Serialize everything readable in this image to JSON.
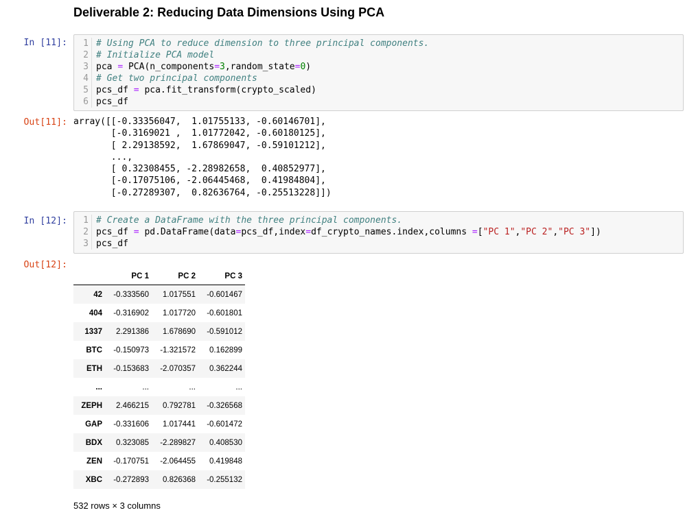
{
  "heading": "Deliverable 2: Reducing Data Dimensions Using PCA",
  "cell11": {
    "in_prompt": "In [11]:",
    "out_prompt": "Out[11]:",
    "lines": [
      {
        "n": "1",
        "t": "# Using PCA to reduce dimension to three principal components."
      },
      {
        "n": "2",
        "t": "# Initialize PCA model"
      },
      {
        "n": "3",
        "t": "pca = PCA(n_components=3,random_state=0)"
      },
      {
        "n": "4",
        "t": "# Get two principal components"
      },
      {
        "n": "5",
        "t": "pcs_df = pca.fit_transform(crypto_scaled)"
      },
      {
        "n": "6",
        "t": "pcs_df"
      }
    ],
    "output": "array([[-0.33356047,  1.01755133, -0.60146701],\n       [-0.3169021 ,  1.01772042, -0.60180125],\n       [ 2.29138592,  1.67869047, -0.59101212],\n       ...,\n       [ 0.32308455, -2.28982658,  0.40852977],\n       [-0.17075106, -2.06445468,  0.41984804],\n       [-0.27289307,  0.82636764, -0.25513228]])"
  },
  "cell12": {
    "in_prompt": "In [12]:",
    "out_prompt": "Out[12]:",
    "lines": [
      {
        "n": "1",
        "t": "# Create a DataFrame with the three principal components."
      },
      {
        "n": "2",
        "t": "pcs_df = pd.DataFrame(data=pcs_df,index=df_crypto_names.index,columns =[\"PC 1\",\"PC 2\",\"PC 3\"])"
      },
      {
        "n": "3",
        "t": "pcs_df"
      }
    ]
  },
  "dataframe": {
    "corner": "",
    "columns": [
      "PC 1",
      "PC 2",
      "PC 3"
    ],
    "rows": [
      {
        "index": "42",
        "values": [
          "-0.333560",
          "1.017551",
          "-0.601467"
        ]
      },
      {
        "index": "404",
        "values": [
          "-0.316902",
          "1.017720",
          "-0.601801"
        ]
      },
      {
        "index": "1337",
        "values": [
          "2.291386",
          "1.678690",
          "-0.591012"
        ]
      },
      {
        "index": "BTC",
        "values": [
          "-0.150973",
          "-1.321572",
          "0.162899"
        ]
      },
      {
        "index": "ETH",
        "values": [
          "-0.153683",
          "-2.070357",
          "0.362244"
        ]
      },
      {
        "index": "...",
        "values": [
          "...",
          "...",
          "..."
        ]
      },
      {
        "index": "ZEPH",
        "values": [
          "2.466215",
          "0.792781",
          "-0.326568"
        ]
      },
      {
        "index": "GAP",
        "values": [
          "-0.331606",
          "1.017441",
          "-0.601472"
        ]
      },
      {
        "index": "BDX",
        "values": [
          "0.323085",
          "-2.289827",
          "0.408530"
        ]
      },
      {
        "index": "ZEN",
        "values": [
          "-0.170751",
          "-2.064455",
          "0.419848"
        ]
      },
      {
        "index": "XBC",
        "values": [
          "-0.272893",
          "0.826368",
          "-0.255132"
        ]
      }
    ],
    "footer": "532 rows × 3 columns"
  },
  "colors": {
    "in_prompt": "#303f9f",
    "out_prompt": "#d84315",
    "comment": "#408080",
    "operator": "#aa22ff",
    "number": "#008000",
    "string": "#ba2121"
  }
}
